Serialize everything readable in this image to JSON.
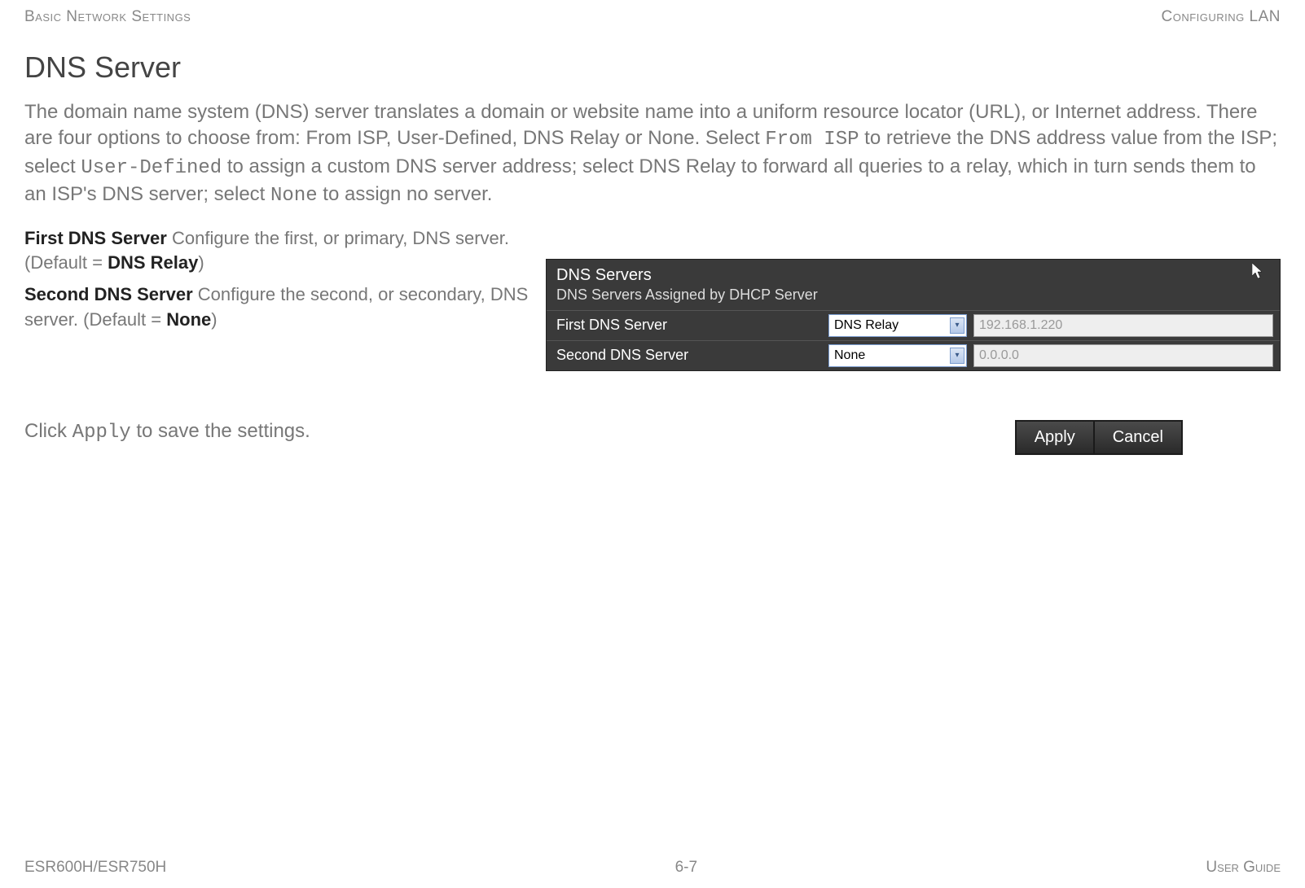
{
  "header": {
    "left": "Basic Network Settings",
    "right": "Configuring LAN"
  },
  "section_title": "DNS Server",
  "intro": {
    "p1a": "The domain name system (DNS) server translates a domain or website name into a uniform resource locator (URL), or Internet address. There are four options to choose from: From ISP, User-Defined, DNS Relay or None. Select ",
    "m1": "From ISP",
    "p1b": " to retrieve the DNS address value from the ISP; select ",
    "m2": "User-Defined",
    "p1c": " to assign a custom DNS server address; select DNS Relay to forward all queries to a relay, which in turn sends them to an ISP's DNS server; select ",
    "m3": "None",
    "p1d": " to assign no server."
  },
  "params": {
    "first": {
      "label": "First DNS Server",
      "desc": "  Configure the first, or primary, DNS server. (Default = ",
      "default": "DNS Relay",
      "close": ")"
    },
    "second": {
      "label": "Second DNS Server",
      "desc": "  Configure the second, or secondary, DNS server. (Default = ",
      "default": "None",
      "close": ")"
    }
  },
  "panel": {
    "title": "DNS Servers",
    "subtitle": "DNS Servers Assigned by DHCP Server",
    "rows": [
      {
        "label": "First DNS Server",
        "select": "DNS Relay",
        "input": "192.168.1.220"
      },
      {
        "label": "Second DNS Server",
        "select": "None",
        "input": "0.0.0.0"
      }
    ]
  },
  "apply": {
    "pre": "Click ",
    "mono": "Apply",
    "post": " to save the settings."
  },
  "buttons": {
    "apply": "Apply",
    "cancel": "Cancel"
  },
  "footer": {
    "left": "ESR600H/ESR750H",
    "center": "6-7",
    "right": "User Guide"
  }
}
